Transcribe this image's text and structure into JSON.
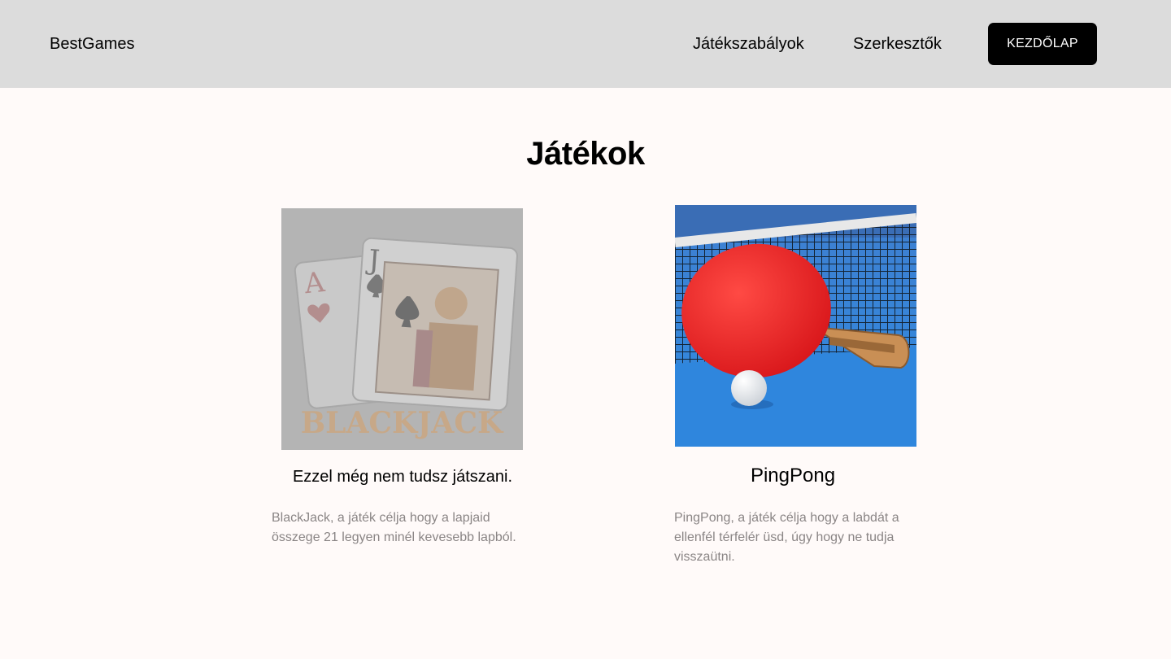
{
  "header": {
    "brand": "BestGames",
    "nav": {
      "rules": "Játékszabályok",
      "editors": "Szerkesztők"
    },
    "home_button": "KEZDŐLAP"
  },
  "main": {
    "title": "Játékok",
    "cards": [
      {
        "image_text": "BLACKJACK",
        "title": "Ezzel még nem tudsz játszani.",
        "description": "BlackJack, a játék célja hogy a lapjaid összege 21 legyen minél kevesebb lapból."
      },
      {
        "title": "PingPong",
        "description": "PingPong, a játék célja hogy a labdát a ellenfél térfelér üsd, úgy hogy ne tudja visszaütni."
      }
    ]
  },
  "colors": {
    "header_bg": "#dcdcdc",
    "page_bg": "#fffaf9",
    "button_bg": "#000000",
    "description_text": "#8a8585"
  }
}
